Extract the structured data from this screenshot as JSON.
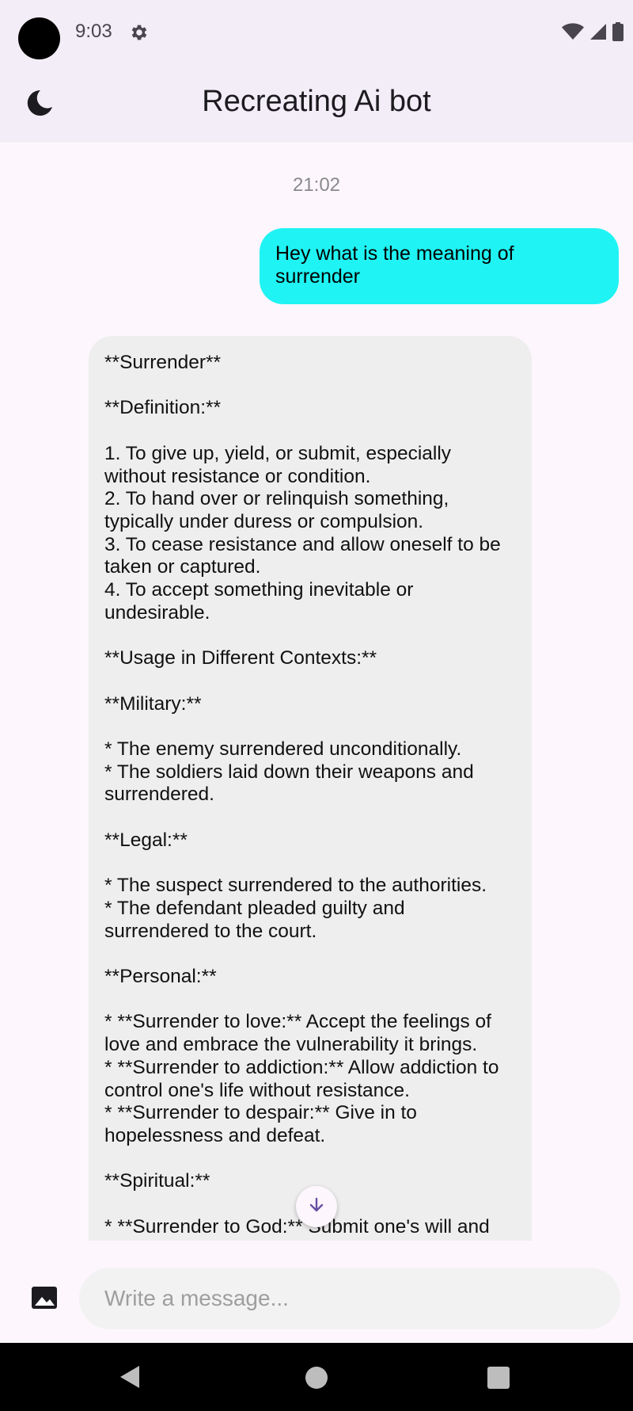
{
  "status_bar": {
    "time": "9:03"
  },
  "app_bar": {
    "title": "Recreating Ai bot"
  },
  "chat": {
    "timestamp": "21:02",
    "messages": [
      {
        "role": "user",
        "text": "Hey what is the meaning of surrender"
      },
      {
        "role": "bot",
        "text": "**Surrender**\n\n**Definition:**\n\n1. To give up, yield, or submit, especially\nwithout resistance or condition.\n2. To hand over or relinquish something,\ntypically under duress or compulsion.\n3. To cease resistance and allow oneself to be\ntaken or captured.\n4. To accept something inevitable or\nundesirable.\n\n**Usage in Different Contexts:**\n\n**Military:**\n\n* The enemy surrendered unconditionally.\n* The soldiers laid down their weapons and\nsurrendered.\n\n**Legal:**\n\n* The suspect surrendered to the authorities.\n* The defendant pleaded guilty and\nsurrendered to the court.\n\n**Personal:**\n\n* **Surrender to love:** Accept the feelings of\nlove and embrace the vulnerability it brings.\n* **Surrender to addiction:** Allow addiction to\ncontrol one's life without resistance.\n* **Surrender to despair:** Give in to\nhopelessness and defeat.\n\n**Spiritual:**\n\n* **Surrender to God:** Submit one's will and\nlife to the divine."
      }
    ]
  },
  "composer": {
    "placeholder": "Write a message...",
    "value": ""
  },
  "icons": {
    "status_settings": "gear-icon",
    "wifi": "wifi-icon",
    "signal": "signal-icon",
    "battery": "battery-icon",
    "theme_toggle": "moon-icon",
    "attach_image": "image-icon",
    "scroll_down": "arrow-down-icon"
  },
  "colors": {
    "user_bubble": "#20f3f3",
    "bot_bubble": "#eeeeee",
    "app_bar": "#f3edf7",
    "background": "#fdf7fd"
  }
}
